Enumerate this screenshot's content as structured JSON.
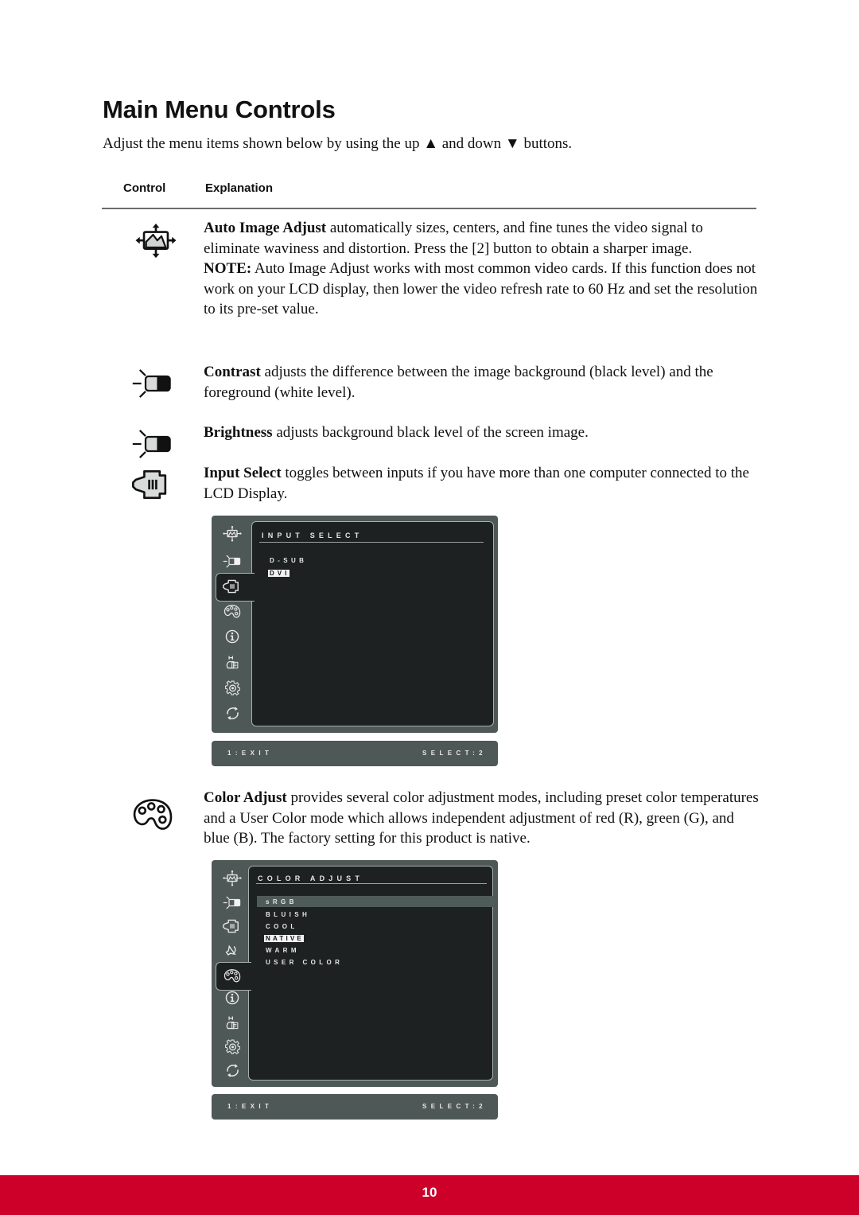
{
  "page": {
    "title": "Main Menu Controls",
    "intro": "Adjust the menu items shown below by using the up ▲ and down ▼ buttons.",
    "page_number": "10",
    "footer_color": "#cd002a"
  },
  "table": {
    "headers": [
      "Control",
      "Explanation"
    ],
    "rows": [
      {
        "icon": "auto-image-adjust-icon",
        "term": "Auto Image Adjust",
        "text": " automatically sizes, centers, and fine tunes the video signal to eliminate waviness and distortion. Press the [2] button to obtain a sharper image.",
        "note_label": "NOTE:",
        "note_text": " Auto Image Adjust works with most common video cards. If this function does not work on your LCD display, then lower the video refresh rate to 60 Hz and set the resolution to its pre-set value."
      },
      {
        "icon": "contrast-icon",
        "term": "Contrast",
        "text": " adjusts the difference between the image background  (black level) and the foreground (white level)."
      },
      {
        "icon": "brightness-icon",
        "term": "Brightness",
        "text": " adjusts background black level of the screen image."
      },
      {
        "icon": "input-select-icon",
        "term": "Input Select",
        "text": " toggles between inputs if you have more than one computer connected to the LCD Display."
      },
      {
        "icon": "color-adjust-icon",
        "term": "Color Adjust",
        "text": " provides several color adjustment modes, including preset color temperatures and a User Color mode which allows independent adjustment of red (R), green (G), and blue (B). The factory setting for this product is native."
      }
    ]
  },
  "osd_input": {
    "title": "INPUT SELECT",
    "items": [
      "D-SUB",
      "DVI"
    ],
    "selected": "DVI",
    "sidebar_icons": [
      "auto-image-adjust",
      "contrast-brightness",
      "input-select",
      "color-adjust",
      "information",
      "manual-image-adjust",
      "setup-menu",
      "memory-recall"
    ],
    "active_icon": "input-select",
    "exit_label": "1:EXIT",
    "select_label": "SELECT:2"
  },
  "osd_color": {
    "title": "COLOR ADJUST",
    "items": [
      "sRGB",
      "BLUISH",
      "COOL",
      "NATIVE",
      "WARM",
      "USER COLOR"
    ],
    "highlighted": "sRGB",
    "selected": "NATIVE",
    "sidebar_icons": [
      "auto-image-adjust",
      "contrast-brightness",
      "input-select",
      "audio-adjust",
      "color-adjust",
      "information",
      "manual-image-adjust",
      "setup-menu",
      "memory-recall"
    ],
    "active_icon": "color-adjust",
    "exit_label": "1:EXIT",
    "select_label": "SELECT:2"
  }
}
